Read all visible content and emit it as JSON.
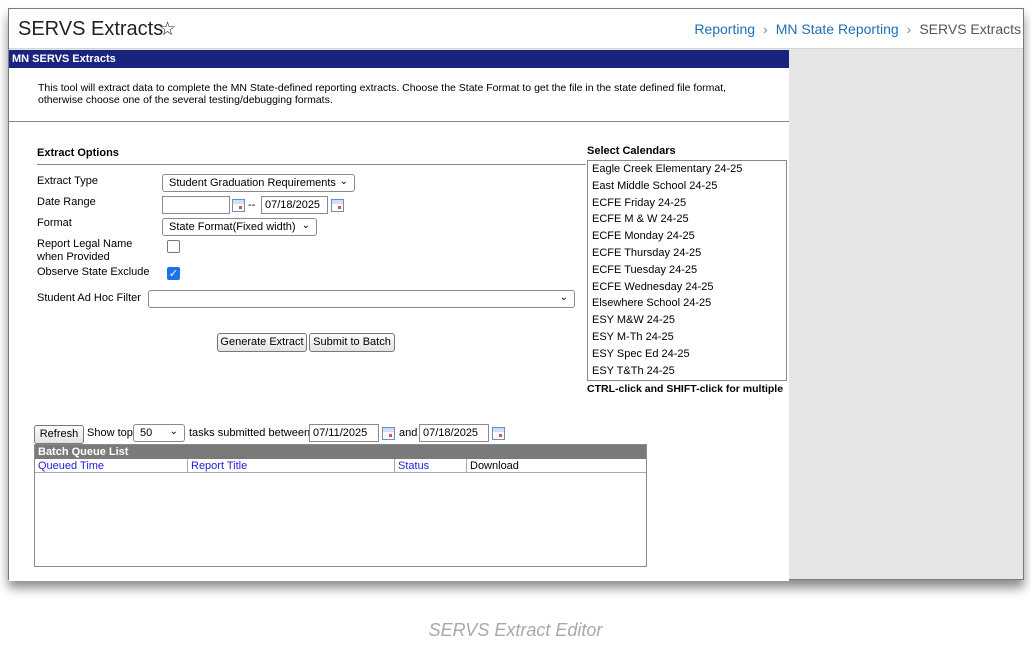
{
  "title_bar": {
    "title": "SERVS Extracts",
    "breadcrumb": [
      "Reporting",
      "MN State Reporting",
      "SERVS Extracts"
    ]
  },
  "tool": {
    "header": "MN SERVS Extracts",
    "description_line1": "This tool will extract data to complete the MN State-defined reporting extracts. Choose the State Format to get the file in the state defined file format,",
    "description_line2": "otherwise choose one of the several testing/debugging formats."
  },
  "extract_options": {
    "section_title": "Extract Options",
    "extract_type_label": "Extract Type",
    "extract_type_value": "Student Graduation Requirements",
    "date_range_label": "Date Range",
    "date_start": "",
    "date_separator": "--",
    "date_end": "07/18/2025",
    "format_label": "Format",
    "format_value": "State Format(Fixed width)",
    "legal_name_label_1": "Report Legal Name",
    "legal_name_label_2": "when Provided",
    "legal_name_checked": false,
    "observe_exclude_label": "Observe State Exclude",
    "observe_exclude_checked": true,
    "ad_hoc_label": "Student Ad Hoc Filter",
    "ad_hoc_value": "",
    "generate_button": "Generate Extract",
    "batch_button": "Submit to Batch"
  },
  "calendars": {
    "title": "Select Calendars",
    "items": [
      "Eagle Creek Elementary 24-25",
      "East Middle School 24-25",
      "ECFE Friday 24-25",
      "ECFE M & W 24-25",
      "ECFE Monday 24-25",
      "ECFE Thursday 24-25",
      "ECFE Tuesday 24-25",
      "ECFE Wednesday 24-25",
      "Elsewhere School 24-25",
      "ESY M&W 24-25",
      "ESY M-Th 24-25",
      "ESY Spec Ed 24-25",
      "ESY T&Th 24-25"
    ],
    "hint": "CTRL-click and SHIFT-click for multiple"
  },
  "batch": {
    "refresh_button": "Refresh",
    "show_top_label": "Show top",
    "show_top_value": "50",
    "between_label": "tasks submitted between",
    "from_date": "07/11/2025",
    "and_label": "and",
    "to_date": "07/18/2025",
    "list_title": "Batch Queue List",
    "columns": [
      "Queued Time",
      "Report Title",
      "Status",
      "Download"
    ]
  },
  "caption": "SERVS Extract Editor"
}
